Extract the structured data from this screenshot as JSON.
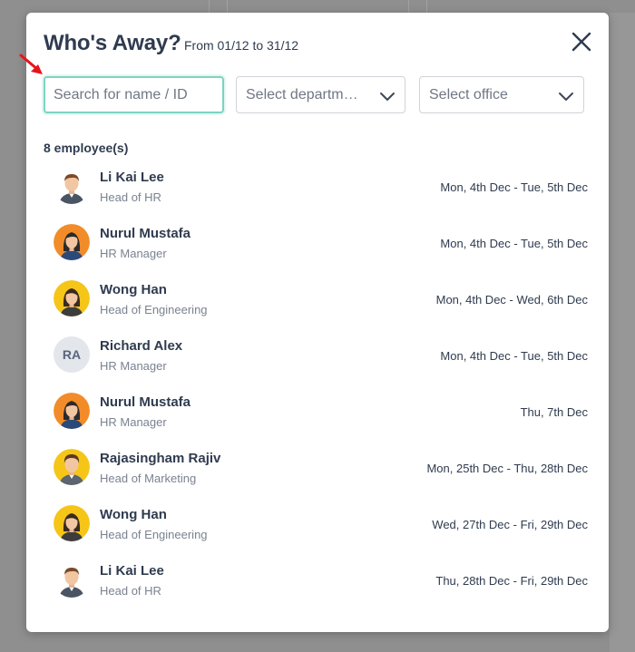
{
  "modal": {
    "title": "Who's Away?",
    "subtitle": "From 01/12 to 31/12"
  },
  "filters": {
    "search_placeholder": "Search for name / ID",
    "department_placeholder": "Select department",
    "office_placeholder": "Select office"
  },
  "summary": {
    "count_label": "8 employee(s)"
  },
  "employees": [
    {
      "name": "Li Kai Lee",
      "role": "Head of HR",
      "dates": "Mon, 4th Dec - Tue, 5th Dec",
      "avatar": "male-avatar-icon"
    },
    {
      "name": "Nurul Mustafa",
      "role": "HR Manager",
      "dates": "Mon, 4th Dec - Tue, 5th Dec",
      "avatar": "female-avatar-orange-icon"
    },
    {
      "name": "Wong Han",
      "role": "Head of Engineering",
      "dates": "Mon, 4th Dec - Wed, 6th Dec",
      "avatar": "female-avatar-yellow-icon"
    },
    {
      "name": "Richard Alex",
      "role": "HR Manager",
      "dates": "Mon, 4th Dec - Tue, 5th Dec",
      "avatar": "initials",
      "initials": "RA"
    },
    {
      "name": "Nurul Mustafa",
      "role": "HR Manager",
      "dates": "Thu, 7th Dec",
      "avatar": "female-avatar-orange-icon"
    },
    {
      "name": "Rajasingham Rajiv",
      "role": "Head of Marketing",
      "dates": "Mon, 25th Dec - Thu, 28th Dec",
      "avatar": "male-avatar-yellow-icon"
    },
    {
      "name": "Wong Han",
      "role": "Head of Engineering",
      "dates": "Wed, 27th Dec - Fri, 29th Dec",
      "avatar": "female-avatar-yellow-icon"
    },
    {
      "name": "Li Kai Lee",
      "role": "Head of HR",
      "dates": "Thu, 28th Dec - Fri, 29th Dec",
      "avatar": "male-avatar-icon"
    }
  ],
  "colors": {
    "accent": "#7dd3c2",
    "annotation_arrow": "#e8141b",
    "text_primary": "#2f3b4f",
    "text_secondary": "#7a8290"
  }
}
